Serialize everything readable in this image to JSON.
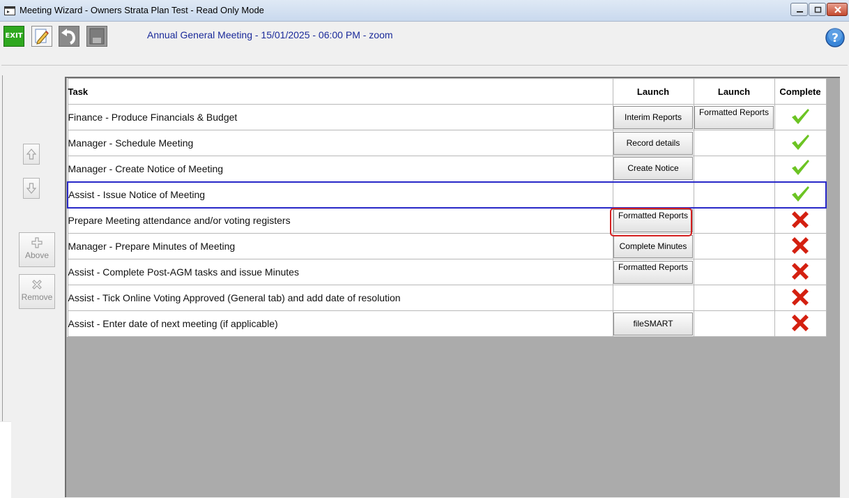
{
  "window": {
    "title": "Meeting Wizard - Owners Strata Plan Test - Read Only Mode"
  },
  "toolbar": {
    "exit_label": "EXIT",
    "meeting_title": "Annual General Meeting - 15/01/2025 - 06:00 PM - zoom"
  },
  "side": {
    "above_label": "Above",
    "remove_label": "Remove"
  },
  "grid": {
    "headers": {
      "task": "Task",
      "launch1": "Launch",
      "launch2": "Launch",
      "complete": "Complete"
    },
    "rows": [
      {
        "task": "Finance - Produce Financials & Budget",
        "launch1": "Interim Reports",
        "launch2": "Formatted Reports",
        "complete": true
      },
      {
        "task": "Manager - Schedule Meeting",
        "launch1": "Record details",
        "launch2": "",
        "complete": true
      },
      {
        "task": "Manager - Create Notice of Meeting",
        "launch1": "Create Notice",
        "launch2": "",
        "complete": true
      },
      {
        "task": "Assist - Issue Notice of Meeting",
        "launch1": "",
        "launch2": "",
        "complete": true
      },
      {
        "task": "Prepare Meeting attendance and/or voting registers",
        "launch1": "Formatted Reports",
        "launch2": "",
        "complete": false
      },
      {
        "task": "Manager - Prepare Minutes of Meeting",
        "launch1": "Complete Minutes",
        "launch2": "",
        "complete": false
      },
      {
        "task": "Assist - Complete Post-AGM tasks and issue Minutes",
        "launch1": "Formatted Reports",
        "launch2": "",
        "complete": false
      },
      {
        "task": "Assist - Tick Online Voting Approved (General tab) and add date of resolution",
        "launch1": "",
        "launch2": "",
        "complete": false
      },
      {
        "task": "Assist - Enter date of next meeting (if applicable)",
        "launch1": "fileSMART",
        "launch2": "",
        "complete": false
      }
    ]
  },
  "colors": {
    "check": "#6cc423",
    "cross": "#d42010",
    "selection": "#2828c8",
    "highlight": "#d42020",
    "title_text": "#1a2a9a"
  }
}
